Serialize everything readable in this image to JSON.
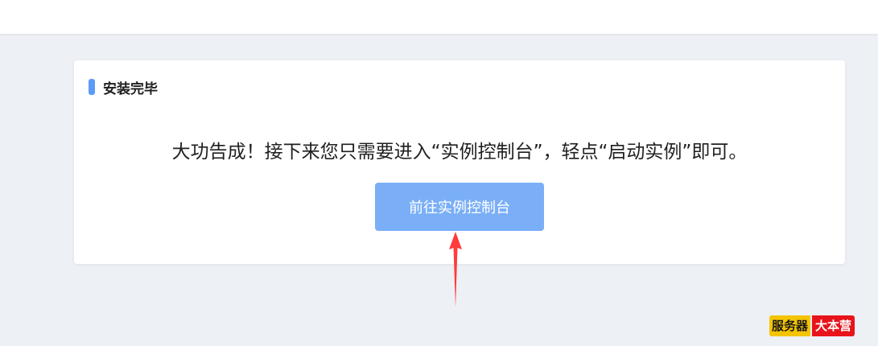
{
  "card": {
    "title": "安装完毕",
    "message": "大功告成！接下来您只需要进入“实例控制台”，轻点“启动实例”即可。",
    "button_label": "前往实例控制台"
  },
  "watermark": {
    "left_text": "服务器",
    "right_text": "大本营"
  },
  "colors": {
    "accent": "#5b9cf7",
    "button": "#7aaff7",
    "arrow": "#ff3b3b",
    "watermark_left": "#f5c400",
    "watermark_right": "#e8141b"
  },
  "icons": {
    "arrow": "up-arrow-icon"
  }
}
